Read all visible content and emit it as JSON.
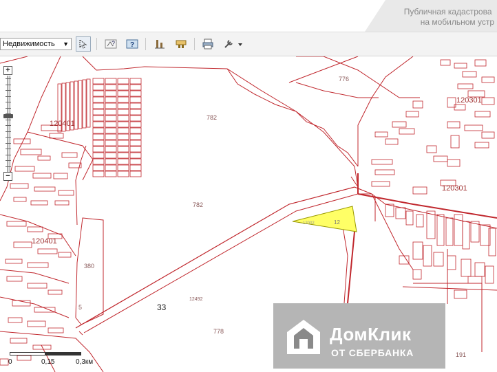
{
  "header": {
    "title_line1": "Публичная кадастрова",
    "title_line2": "на мобильном устр"
  },
  "toolbar": {
    "layer_select_value": "Недвижимость",
    "tools": [
      {
        "icon": "cursor-arrow-icon"
      },
      {
        "icon": "identify-icon"
      },
      {
        "icon": "info-map-icon"
      },
      {
        "icon": "measure-icon"
      },
      {
        "icon": "parcel-icon"
      },
      {
        "icon": "print-icon"
      },
      {
        "icon": "tools-dropdown-icon"
      }
    ]
  },
  "map": {
    "zoom_in_label": "+",
    "zoom_out_label": "−",
    "zoom_level_fraction": 0.58,
    "labels": {
      "p776": "776",
      "p782a": "782",
      "p782b": "782",
      "p120301a": "120301",
      "p120301b": "120301",
      "p120401a": "120401",
      "p120401b": "120401",
      "p380": "380",
      "p33": "33",
      "p778": "778",
      "p191": "191",
      "p12492": "12492",
      "p5": "5"
    },
    "highlight_color": "#ffff66",
    "line_color": "#c0272d"
  },
  "scale": {
    "label0": "0",
    "label1": "0,15",
    "label2": "0,3км"
  },
  "watermark": {
    "line1": "ДомКлик",
    "line2": "ОТ СБЕРБАНКА"
  }
}
